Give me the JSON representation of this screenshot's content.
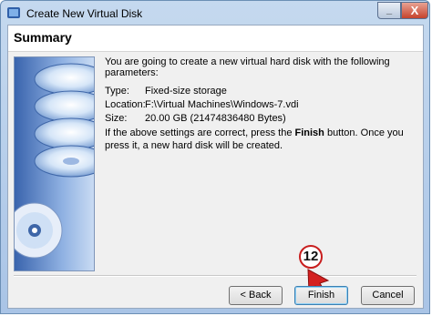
{
  "window": {
    "title": "Create New Virtual Disk",
    "minimize_label": "_",
    "close_label": "X"
  },
  "page": {
    "title": "Summary"
  },
  "intro": "You are going to create a new virtual hard disk with the following parameters:",
  "params": [
    {
      "key": "Type:",
      "value": "Fixed-size storage"
    },
    {
      "key": "Location:",
      "value": "F:\\Virtual Machines\\Windows-7.vdi"
    },
    {
      "key": "Size:",
      "value": "20.00 GB (21474836480 Bytes)"
    }
  ],
  "note": {
    "before": "If the above settings are correct, press the ",
    "bold": "Finish",
    "after": " button. Once you press it, a new hard disk will be created."
  },
  "buttons": {
    "back": "< Back",
    "finish": "Finish",
    "cancel": "Cancel"
  },
  "annotation": {
    "step": "12"
  },
  "colors": {
    "accent_red": "#c81e1e",
    "title_bar": "#b9d1ea"
  },
  "icons": [
    "app-icon",
    "disk-stack-icon",
    "cd-icon",
    "arrow-icon"
  ]
}
